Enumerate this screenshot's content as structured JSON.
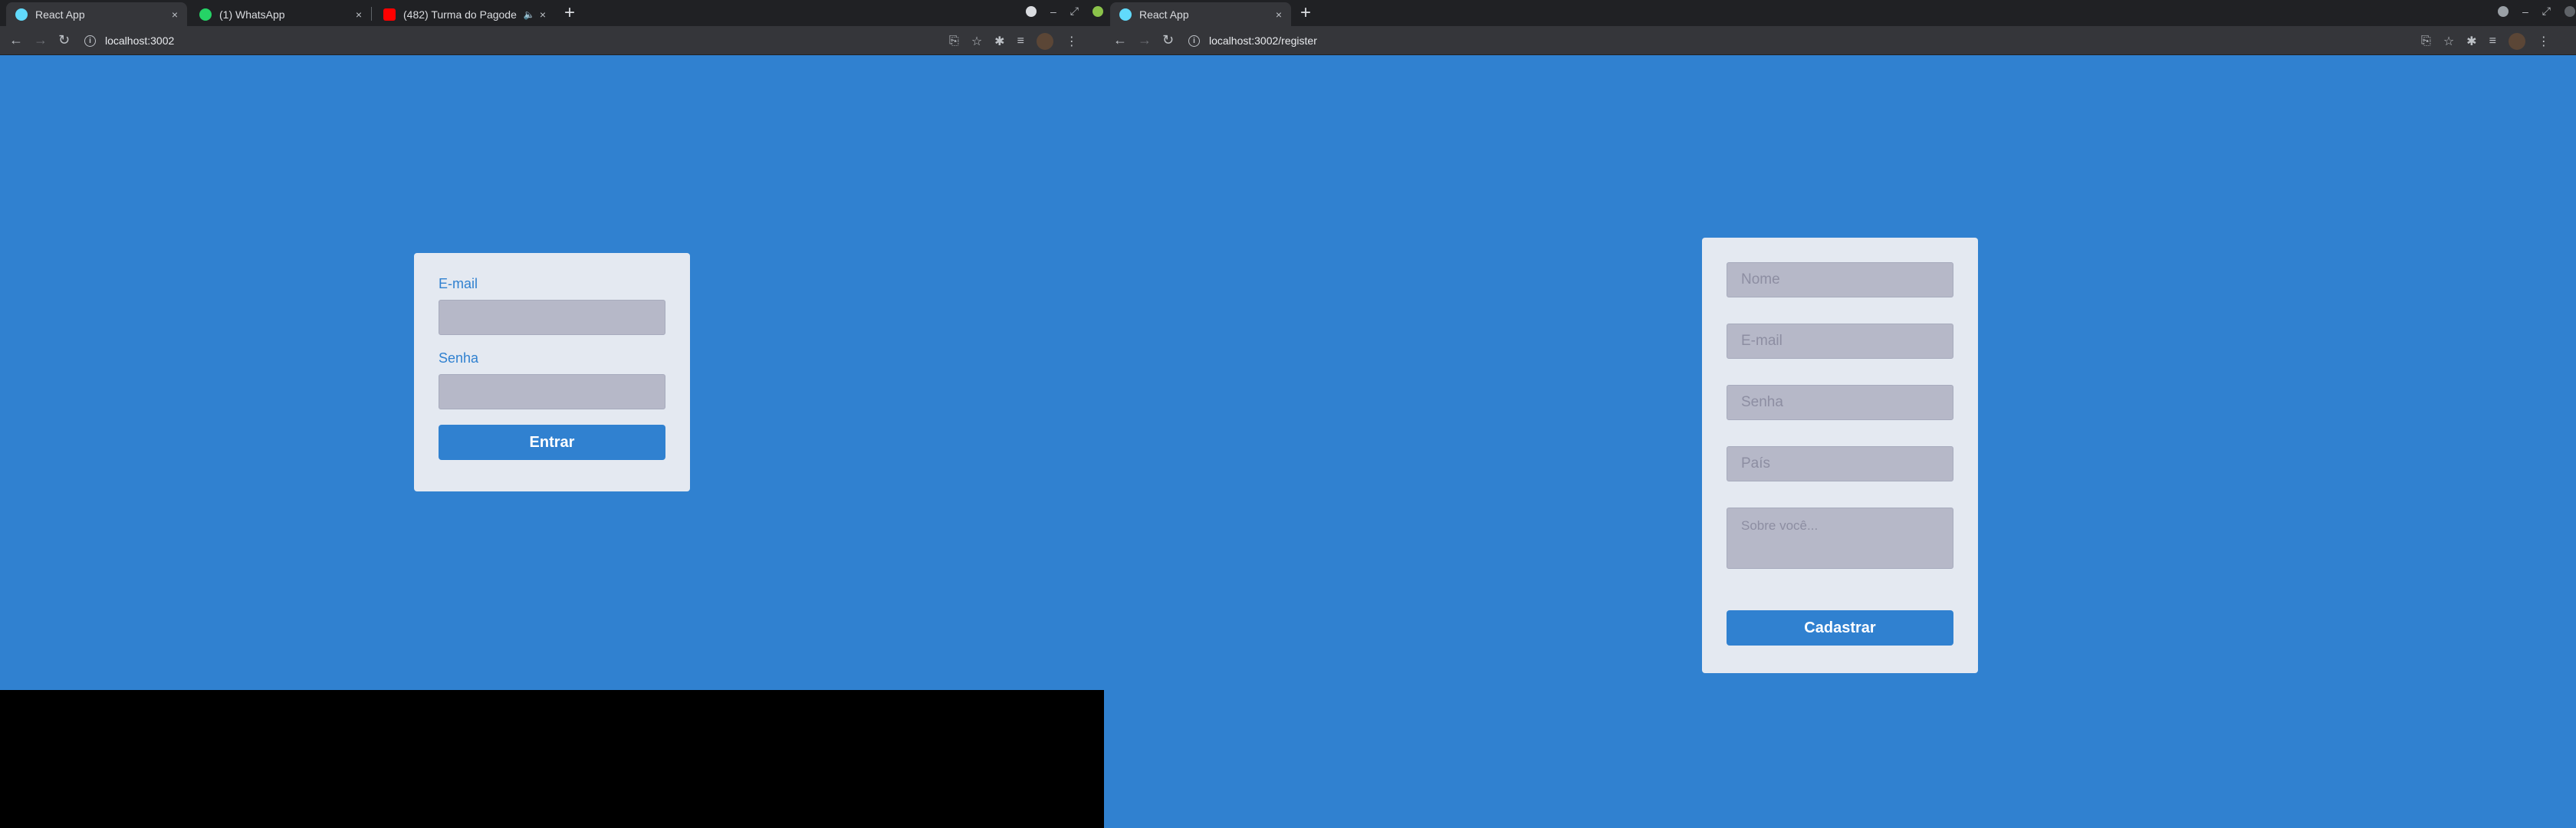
{
  "left_window": {
    "tabs": [
      {
        "title": "React App",
        "favicon_color": "#61dafb",
        "active": true
      },
      {
        "title": "(1) WhatsApp",
        "favicon_color": "#25d366",
        "active": false
      },
      {
        "title": "(482) Turma do Pagode -",
        "favicon_color": "#ff0000",
        "active": false
      }
    ],
    "url": "localhost:3002"
  },
  "right_window": {
    "tabs": [
      {
        "title": "React App",
        "favicon_color": "#61dafb",
        "active": true
      }
    ],
    "url": "localhost:3002/register"
  },
  "login_form": {
    "email_label": "E-mail",
    "password_label": "Senha",
    "submit_label": "Entrar"
  },
  "register_form": {
    "name_placeholder": "Nome",
    "email_placeholder": "E-mail",
    "password_placeholder": "Senha",
    "country_placeholder": "País",
    "about_placeholder": "Sobre você...",
    "submit_label": "Cadastrar"
  },
  "icons": {
    "close": "×",
    "new_tab": "+",
    "back": "←",
    "forward": "→",
    "reload": "↻",
    "site_info": "i",
    "translate": "⎘",
    "star": "☆",
    "extensions": "✱",
    "reading_list": "≡",
    "menu": "⋮",
    "minimize": "–",
    "restore": "⤢",
    "mute": "🔈"
  },
  "colors": {
    "page_background": "#3081d0",
    "card_background": "#e4e9f1",
    "input_background": "#b6b8c8",
    "accent": "#3081d0"
  }
}
